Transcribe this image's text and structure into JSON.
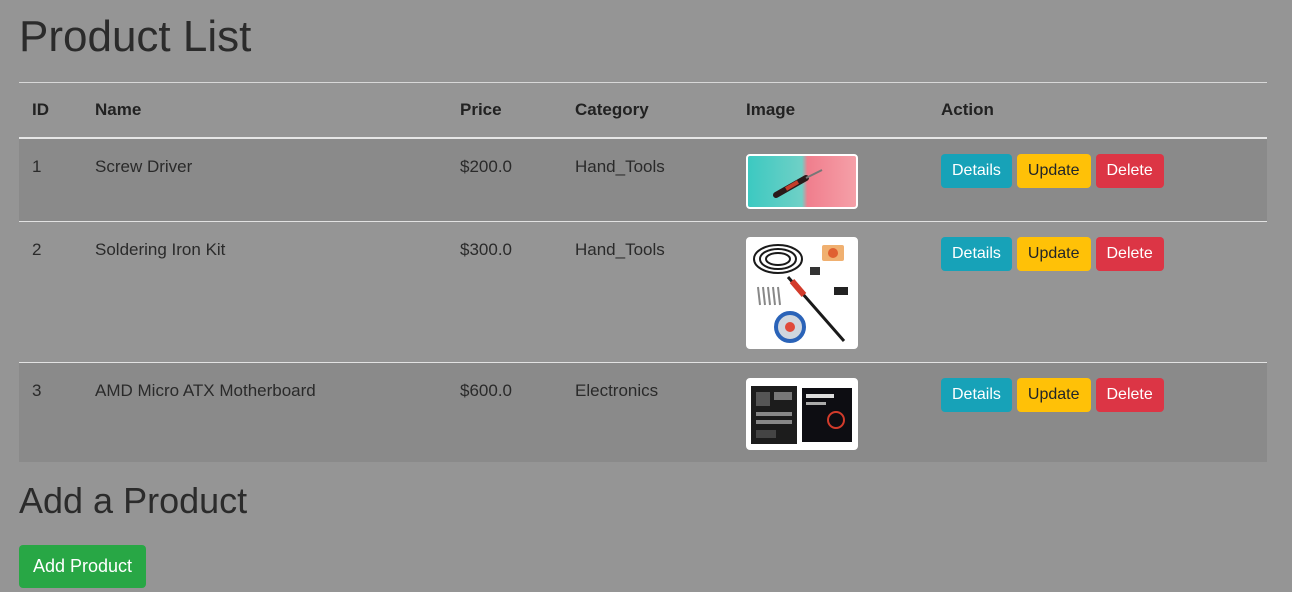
{
  "page": {
    "title": "Product List",
    "add_section_title": "Add a Product",
    "add_button_label": "Add Product"
  },
  "table": {
    "headers": [
      "ID",
      "Name",
      "Price",
      "Category",
      "Image",
      "Action"
    ],
    "rows": [
      {
        "id": "1",
        "name": "Screw Driver",
        "price": "$200.0",
        "category": "Hand_Tools",
        "image_icon": "screwdriver-image"
      },
      {
        "id": "2",
        "name": "Soldering Iron Kit",
        "price": "$300.0",
        "category": "Hand_Tools",
        "image_icon": "soldering-iron-kit-image"
      },
      {
        "id": "3",
        "name": "AMD Micro ATX Motherboard",
        "price": "$600.0",
        "category": "Electronics",
        "image_icon": "motherboard-image"
      }
    ],
    "actions": {
      "details_label": "Details",
      "update_label": "Update",
      "delete_label": "Delete"
    }
  },
  "colors": {
    "background": "#959595",
    "details": "#17a2b8",
    "update": "#ffc107",
    "delete": "#dc3545",
    "add": "#28a745"
  }
}
